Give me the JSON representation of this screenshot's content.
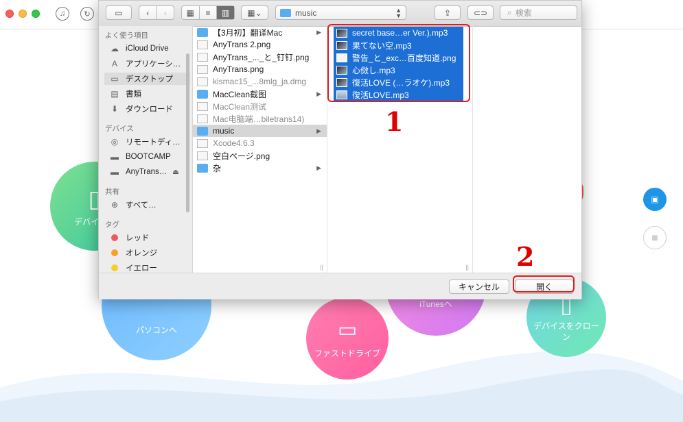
{
  "app": {
    "circles": {
      "device_label": "デバイスを",
      "pc_label": "パソコンへ",
      "fast_drive_label": "ファストドライブ",
      "itunes_label": "iTunesへ",
      "clone_label": "デバイスをクローン"
    },
    "annotations": {
      "step1": "1",
      "step2": "2"
    }
  },
  "toolbar": {
    "path_folder": "music",
    "search_placeholder": "検索"
  },
  "sidebar": {
    "favorites_header": "よく使う項目",
    "favorites": [
      {
        "label": "iCloud Drive",
        "icon": "cloud-icon"
      },
      {
        "label": "アプリケーシ…",
        "icon": "applications-icon"
      },
      {
        "label": "デスクトップ",
        "icon": "desktop-icon"
      },
      {
        "label": "書類",
        "icon": "documents-icon"
      },
      {
        "label": "ダウンロード",
        "icon": "download-icon"
      }
    ],
    "devices_header": "デバイス",
    "devices": [
      {
        "label": "リモートディ…",
        "icon": "disc-icon"
      },
      {
        "label": "BOOTCAMP",
        "icon": "disk-icon"
      },
      {
        "label": "AnyTrans…",
        "icon": "disk-icon"
      }
    ],
    "shared_header": "共有",
    "shared": [
      {
        "label": "すべて…",
        "icon": "network-icon"
      }
    ],
    "tags_header": "タグ",
    "tags": [
      {
        "label": "レッド",
        "color": "#f0595a"
      },
      {
        "label": "オレンジ",
        "color": "#f7a12a"
      },
      {
        "label": "イエロー",
        "color": "#f6cf2a"
      }
    ]
  },
  "column1": {
    "items": [
      {
        "label": "【3月初】翻译Mac",
        "kind": "folder",
        "has_children": true
      },
      {
        "label": "AnyTrans 2.png",
        "kind": "file"
      },
      {
        "label": "AnyTrans_..._と_钉钉.png",
        "kind": "file"
      },
      {
        "label": "AnyTrans.png",
        "kind": "file"
      },
      {
        "label": "kismac15_...8mlg_ja.dmg",
        "kind": "file",
        "dim": true
      },
      {
        "label": "MacClean截图",
        "kind": "folder",
        "has_children": true
      },
      {
        "label": "MacClean测试",
        "kind": "file",
        "dim": true
      },
      {
        "label": "Mac电脑端…biletrans14)",
        "kind": "file",
        "dim": true
      },
      {
        "label": "music",
        "kind": "folder",
        "has_children": true,
        "selected": true
      },
      {
        "label": "Xcode4.6.3",
        "kind": "file",
        "dim": true
      },
      {
        "label": "空白ページ.png",
        "kind": "file"
      },
      {
        "label": "杂",
        "kind": "folder",
        "has_children": true
      }
    ]
  },
  "column2": {
    "items": [
      {
        "label": "secret base…er Ver.).mp3"
      },
      {
        "label": "果てない空.mp3"
      },
      {
        "label": "警告_と_exc…百度知道.png"
      },
      {
        "label": "心傚し.mp3"
      },
      {
        "label": "復活LOVE (…ラオケ).mp3"
      },
      {
        "label": "復活LOVE.mp3"
      }
    ]
  },
  "footer": {
    "cancel_label": "キャンセル",
    "open_label": "開く"
  }
}
